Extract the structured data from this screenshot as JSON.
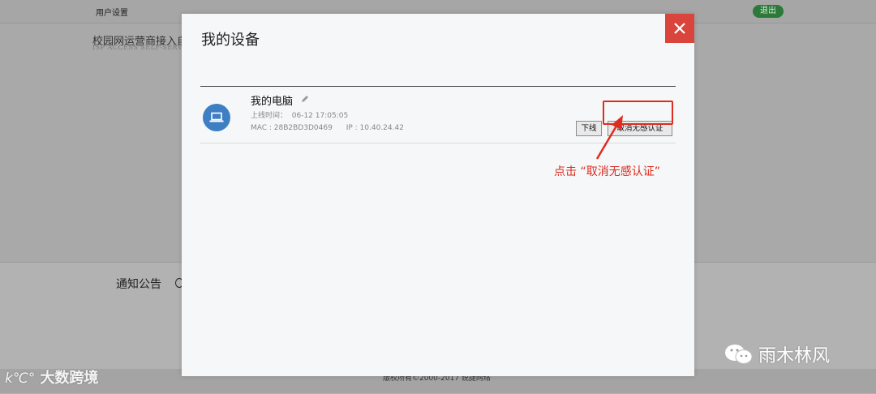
{
  "background": {
    "topbar": {
      "user_settings": "用户设置",
      "logout_label": "退出"
    },
    "heading": "校园网运营商接入自",
    "subheading": "ISP ACCESS SELF-SERV",
    "notice_title": "通知公告",
    "copyright": "版权所有©2000-2017 锐捷网络"
  },
  "modal": {
    "title": "我的设备",
    "close_icon": "close-icon",
    "device": {
      "icon": "laptop-icon",
      "name": "我的电脑",
      "edit_icon": "pencil-icon",
      "online_label": "上线时间：",
      "online_time": "06-12 17:05:05",
      "mac_label": "MAC : 28B2BD3D0469",
      "ip_label": "IP : 10.40.24.42",
      "offline_button": "下线",
      "cancel_auth_button": "取消无感认证"
    }
  },
  "annotation": {
    "text": "点击 “取消无感认证”",
    "color": "#e02b20"
  },
  "watermarks": {
    "left": "大数跨境",
    "right": "雨木林风"
  },
  "colors": {
    "accent_red": "#d9443c",
    "avatar_blue": "#3e7fc3",
    "logout_green": "#2c7a3a"
  }
}
